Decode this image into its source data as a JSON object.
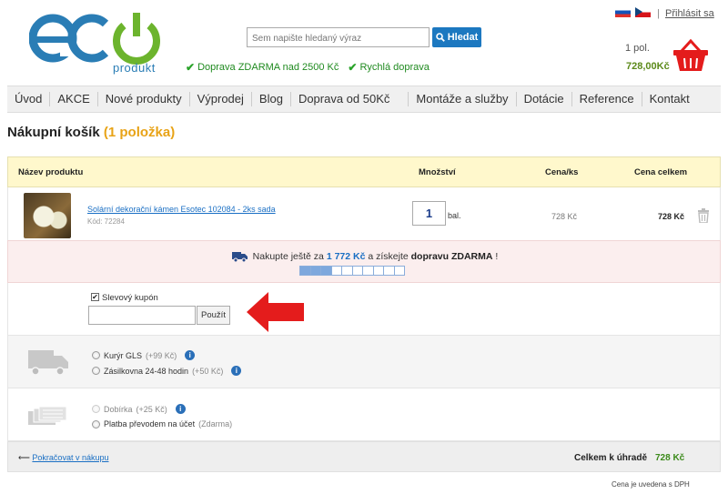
{
  "header": {
    "logo_sub": "produkt",
    "search_placeholder": "Sem napište hledaný výraz",
    "search_button": "Hledat",
    "ship_free": "Doprava ZDARMA nad 2500 Kč",
    "ship_fast": "Rychlá doprava",
    "login": "Přihlásit sa",
    "separator": "|",
    "cart_count": "1 pol.",
    "cart_total": "728,00Kč"
  },
  "nav": [
    "Úvod",
    "AKCE",
    "Nové produkty",
    "Výprodej",
    "Blog",
    "Doprava od 50Kč",
    "Montáže a služby",
    "Dotácie",
    "Reference",
    "Kontakt"
  ],
  "page": {
    "title": "Nákupní košík",
    "count": "(1 položka)"
  },
  "table": {
    "col_name": "Název produktu",
    "col_qty": "Množství",
    "col_price": "Cena/ks",
    "col_total": "Cena celkem"
  },
  "item": {
    "name": "Solární dekorační kámen Esotec 102084 - 2ks sada",
    "code": "Kód: 72284",
    "qty": "1",
    "unit": "bal.",
    "price": "728 Kč",
    "total": "728 Kč"
  },
  "free_shipping": {
    "prefix": "Nakupte ještě za",
    "amount": "1 772 Kč",
    "middle": "a získejte",
    "bold": "dopravu ZDARMA",
    "suffix": "!",
    "progress_fraction": 0.3
  },
  "coupon": {
    "label": "Slevový kupón",
    "button": "Použít",
    "checked": true
  },
  "shipping": [
    {
      "label": "Kurýr GLS",
      "extra": "(+99 Kč)"
    },
    {
      "label": "Zásilkovna 24-48 hodin",
      "extra": "(+50 Kč)"
    }
  ],
  "payment": [
    {
      "label": "Dobírka",
      "extra": "(+25 Kč)",
      "disabled": true
    },
    {
      "label": "Platba převodem na účet",
      "extra": "(Zdarma)",
      "disabled": false
    }
  ],
  "footer": {
    "back": "Pokračovat v nákupu",
    "grand_label": "Celkem k úhradě",
    "grand_value": "728 Kč",
    "vat_note": "Cena je uvedena s DPH"
  },
  "colors": {
    "accent_blue": "#1c78c0",
    "accent_orange": "#e8a317",
    "green": "#2aa32a",
    "red_arrow": "#e41c1c"
  }
}
